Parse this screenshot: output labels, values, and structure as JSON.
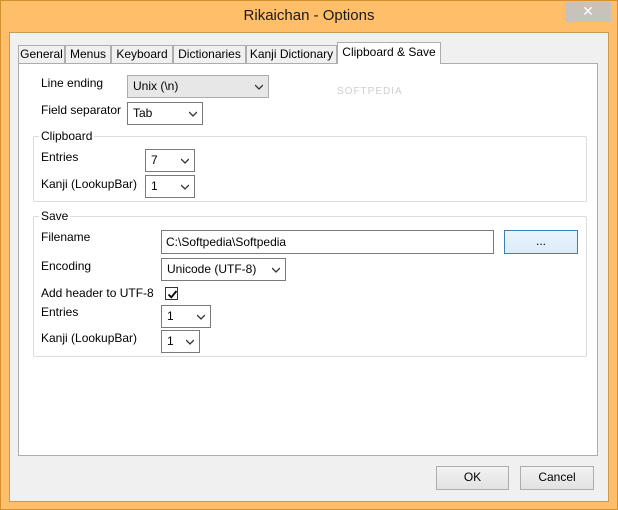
{
  "window": {
    "title": "Rikaichan - Options",
    "close_glyph": "✕"
  },
  "tabs": [
    {
      "label": "General"
    },
    {
      "label": "Menus"
    },
    {
      "label": "Keyboard"
    },
    {
      "label": "Dictionaries"
    },
    {
      "label": "Kanji Dictionary"
    },
    {
      "label": "Clipboard & Save",
      "active": true
    }
  ],
  "general": {
    "line_ending_label": "Line ending",
    "line_ending_value": "Unix (\\n)",
    "field_separator_label": "Field separator",
    "field_separator_value": "Tab"
  },
  "clipboard": {
    "title": "Clipboard",
    "entries_label": "Entries",
    "entries_value": "7",
    "kanji_label": "Kanji (LookupBar)",
    "kanji_value": "1"
  },
  "save": {
    "title": "Save",
    "filename_label": "Filename",
    "filename_value": "C:\\Softpedia\\Softpedia",
    "browse_label": "...",
    "encoding_label": "Encoding",
    "encoding_value": "Unicode (UTF-8)",
    "header_label": "Add header to UTF-8",
    "header_checked": true,
    "entries_label": "Entries",
    "entries_value": "1",
    "kanji_label": "Kanji (LookupBar)",
    "kanji_value": "1"
  },
  "footer": {
    "ok_label": "OK",
    "cancel_label": "Cancel"
  },
  "watermark": "SOFTPEDIA"
}
